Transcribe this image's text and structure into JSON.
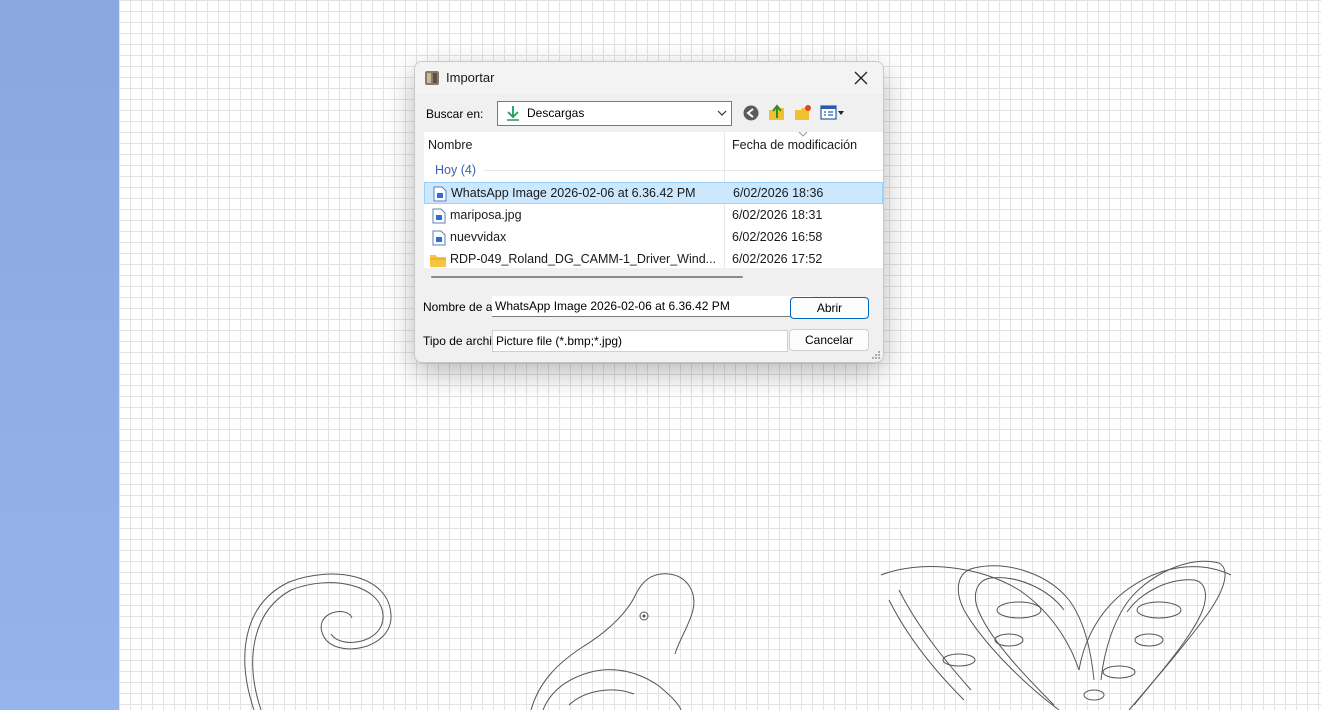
{
  "app": {
    "colors": {
      "left_panel": "#8aa7df",
      "grid": "#e3e3e3",
      "selection": "#cce8ff",
      "group_label": "#3b62ad",
      "accent": "#0067c0"
    }
  },
  "dialog": {
    "title": "Importar",
    "title_icon": "importer-icon",
    "look_in": {
      "label": "Buscar en:",
      "value": "Descargas",
      "icon": "download-arrow-icon"
    },
    "toolbar": [
      {
        "name": "back-icon"
      },
      {
        "name": "up-folder-icon"
      },
      {
        "name": "new-folder-icon"
      },
      {
        "name": "view-menu-icon"
      }
    ],
    "columns": {
      "name": "Nombre",
      "date": "Fecha de modificación"
    },
    "group": "Hoy (4)",
    "files": [
      {
        "name": "WhatsApp Image 2026-02-06 at 6.36.42 PM",
        "date": "6/02/2026 18:36",
        "type": "image",
        "selected": true
      },
      {
        "name": "mariposa.jpg",
        "date": "6/02/2026 18:31",
        "type": "image",
        "selected": false
      },
      {
        "name": "nuevvidax",
        "date": "6/02/2026 16:58",
        "type": "image",
        "selected": false
      },
      {
        "name": "RDP-049_Roland_DG_CAMM-1_Driver_Wind...",
        "date": "6/02/2026 17:52",
        "type": "folder",
        "selected": false
      }
    ],
    "file_name": {
      "label": "Nombre de archivo:",
      "value": "WhatsApp Image 2026-02-06 at 6.36.42 PM"
    },
    "file_type": {
      "label": "Tipo de archivo:",
      "value": "Picture file (*.bmp;*.jpg)"
    },
    "buttons": {
      "open": "Abrir",
      "cancel": "Cancelar"
    }
  }
}
